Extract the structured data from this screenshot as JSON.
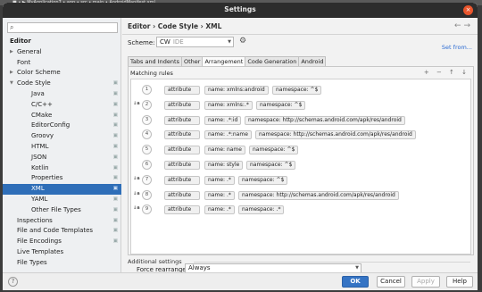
{
  "background_strip": "■ • ▶ MyApplication7 • app • src • main • AndroidManifest.xml",
  "window": {
    "title": "Settings",
    "close_glyph": "×"
  },
  "sidebar": {
    "search": {
      "value": "",
      "icon": "search-icon"
    },
    "items": [
      {
        "label": "Editor",
        "level": 0,
        "arrow": "",
        "header": true
      },
      {
        "label": "General",
        "level": 1,
        "arrow": "▶"
      },
      {
        "label": "Font",
        "level": 1,
        "arrow": ""
      },
      {
        "label": "Color Scheme",
        "level": 1,
        "arrow": "▶"
      },
      {
        "label": "Code Style",
        "level": 1,
        "arrow": "▼",
        "copy": true
      },
      {
        "label": "Java",
        "level": 2,
        "arrow": "",
        "copy": true
      },
      {
        "label": "C/C++",
        "level": 2,
        "arrow": "",
        "copy": true
      },
      {
        "label": "CMake",
        "level": 2,
        "arrow": "",
        "copy": true
      },
      {
        "label": "EditorConfig",
        "level": 2,
        "arrow": "",
        "copy": true
      },
      {
        "label": "Groovy",
        "level": 2,
        "arrow": "",
        "copy": true
      },
      {
        "label": "HTML",
        "level": 2,
        "arrow": "",
        "copy": true
      },
      {
        "label": "JSON",
        "level": 2,
        "arrow": "",
        "copy": true
      },
      {
        "label": "Kotlin",
        "level": 2,
        "arrow": "",
        "copy": true
      },
      {
        "label": "Properties",
        "level": 2,
        "arrow": "",
        "copy": true
      },
      {
        "label": "XML",
        "level": 2,
        "arrow": "",
        "copy": true,
        "selected": true
      },
      {
        "label": "YAML",
        "level": 2,
        "arrow": "",
        "copy": true
      },
      {
        "label": "Other File Types",
        "level": 2,
        "arrow": "",
        "copy": true
      },
      {
        "label": "Inspections",
        "level": 1,
        "arrow": "",
        "copy": true
      },
      {
        "label": "File and Code Templates",
        "level": 1,
        "arrow": "",
        "copy": true
      },
      {
        "label": "File Encodings",
        "level": 1,
        "arrow": "",
        "copy": true
      },
      {
        "label": "Live Templates",
        "level": 1,
        "arrow": ""
      },
      {
        "label": "File Types",
        "level": 1,
        "arrow": ""
      }
    ]
  },
  "main": {
    "breadcrumb": "Editor › Code Style › XML",
    "nav_arrows": "← →",
    "scheme": {
      "label": "Scheme:",
      "value": "CW",
      "suffix": "IDE"
    },
    "set_from": "Set from...",
    "tabs": [
      "Tabs and Indents",
      "Other",
      "Arrangement",
      "Code Generation",
      "Android"
    ],
    "active_tab": "Arrangement",
    "matching_rules_label": "Matching rules",
    "rule_tools": "+ − ↑ ↓",
    "rules": [
      {
        "n": "1",
        "sort": false,
        "name": "name: xmlns:android",
        "namespace": "namespace: ^$"
      },
      {
        "n": "2",
        "sort": true,
        "name": "name: xmlns:.*",
        "namespace": "namespace: ^$"
      },
      {
        "n": "3",
        "sort": false,
        "name": "name: .*:id",
        "namespace": "namespace: http://schemas.android.com/apk/res/android"
      },
      {
        "n": "4",
        "sort": false,
        "name": "name: .*:name",
        "namespace": "namespace: http://schemas.android.com/apk/res/android"
      },
      {
        "n": "5",
        "sort": false,
        "name": "name: name",
        "namespace": "namespace: ^$"
      },
      {
        "n": "6",
        "sort": false,
        "name": "name: style",
        "namespace": "namespace: ^$"
      },
      {
        "n": "7",
        "sort": true,
        "name": "name: .*",
        "namespace": "namespace: ^$"
      },
      {
        "n": "8",
        "sort": true,
        "name": "name: .*",
        "namespace": "namespace: http://schemas.android.com/apk/res/android"
      },
      {
        "n": "9",
        "sort": true,
        "name": "name: .*",
        "namespace": "namespace: .*"
      }
    ],
    "rule_type": "attribute",
    "sort_glyph": "↓a",
    "additional_settings": "Additional settings",
    "force_rearrange": {
      "label": "Force rearrange:",
      "value": "Always"
    }
  },
  "buttons": {
    "ok": "OK",
    "cancel": "Cancel",
    "apply": "Apply",
    "help": "Help",
    "help_q": "?"
  }
}
